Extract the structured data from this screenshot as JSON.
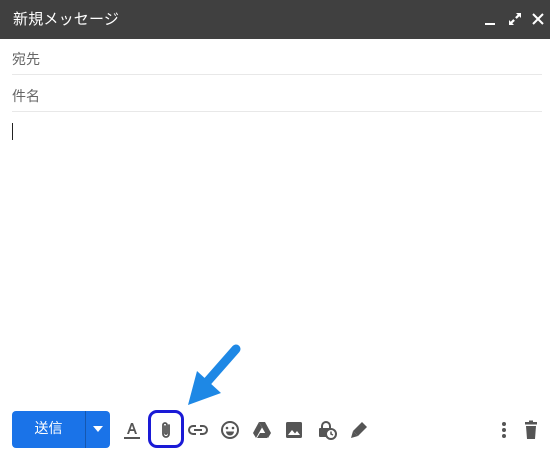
{
  "window": {
    "title": "新規メッセージ",
    "controls": [
      "minimize-icon",
      "expand-icon",
      "close-icon"
    ]
  },
  "fields": {
    "to_label": "宛先",
    "subject_label": "件名"
  },
  "toolbar": {
    "send_label": "送信",
    "tools": [
      "text-format-icon",
      "attach-file-icon",
      "insert-link-icon",
      "emoji-icon",
      "google-drive-icon",
      "insert-photo-icon",
      "confidential-mode-icon",
      "signature-icon"
    ],
    "more_options_icon": "more-vert-icon",
    "discard_icon": "trash-icon"
  },
  "annotation": {
    "arrow_color": "#1e88e5",
    "highlight_color": "#1a1ad6"
  },
  "colors": {
    "title_bar": "#404040",
    "send_button": "#1a73e8",
    "icon": "#555555"
  }
}
